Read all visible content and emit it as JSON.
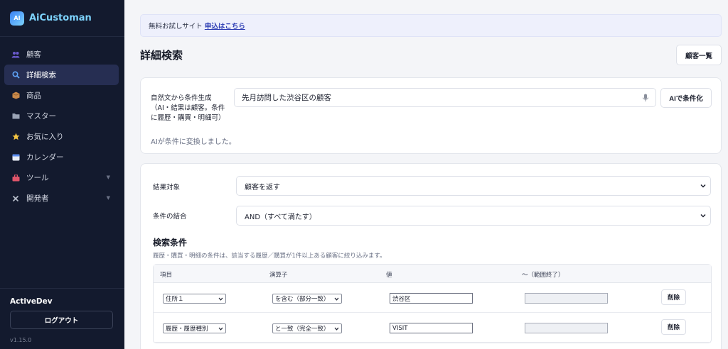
{
  "app": {
    "logo_text": "AI",
    "name": "AiCustoman"
  },
  "sidebar": {
    "items": [
      {
        "label": "顧客",
        "icon": "users-icon"
      },
      {
        "label": "詳細検索",
        "icon": "search-icon",
        "active": true
      },
      {
        "label": "商品",
        "icon": "box-icon"
      },
      {
        "label": "マスター",
        "icon": "folder-icon"
      },
      {
        "label": "お気に入り",
        "icon": "star-icon"
      },
      {
        "label": "カレンダー",
        "icon": "calendar-icon"
      },
      {
        "label": "ツール",
        "icon": "toolbox-icon",
        "expandable": true
      },
      {
        "label": "開発者",
        "icon": "tools-icon",
        "expandable": true
      }
    ],
    "user_name": "ActiveDev",
    "logout_label": "ログアウト",
    "version": "v1.15.0"
  },
  "notice": {
    "text": "無料お試しサイト",
    "link_text": "申込はこちら"
  },
  "page": {
    "title": "詳細検索",
    "list_button": "顧客一覧"
  },
  "ai": {
    "label": "自然文から条件生成（AI・結果は顧客。条件に履歴・購買・明細可）",
    "input_value": "先月訪問した渋谷区の顧客",
    "button_label": "AIで条件化",
    "status": "AIが条件に変換しました。"
  },
  "search": {
    "result_target_label": "結果対象",
    "result_target_value": "顧客を返す",
    "combine_label": "条件の結合",
    "combine_value": "AND（すべて満たす）",
    "section_title": "検索条件",
    "section_desc": "履歴・購買・明細の条件は、該当する履歴／購買が1件以上ある顧客に絞り込みます。",
    "columns": [
      "項目",
      "演算子",
      "値",
      "〜（範囲終了）"
    ],
    "rows": [
      {
        "field": "住所１",
        "operator": "を含む（部分一致）",
        "value": "渋谷区",
        "value_end": "",
        "delete_label": "削除"
      },
      {
        "field": "履歴・履歴種別",
        "operator": "と一致（完全一致）",
        "value": "VISIT",
        "value_end": "",
        "delete_label": "削除"
      }
    ]
  },
  "colors": {
    "sidebar_bg": "#131a2e",
    "brand": "#7dd3fc",
    "accent_link": "#2b3bb3",
    "notice_bg": "#eef0fc"
  }
}
